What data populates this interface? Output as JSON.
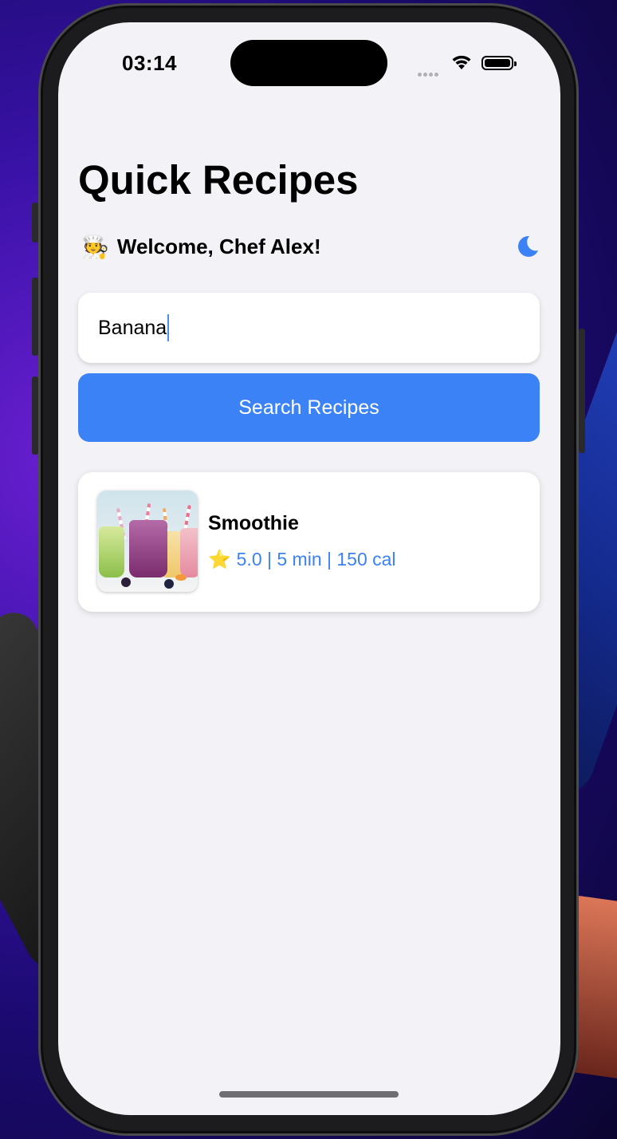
{
  "status_bar": {
    "time": "03:14"
  },
  "app": {
    "title": "Quick Recipes",
    "welcome_emoji": "🧑‍🍳",
    "welcome_text": "Welcome, Chef Alex!",
    "theme_toggle_icon": "moon-icon"
  },
  "search": {
    "value": "Banana",
    "button_label": "Search Recipes"
  },
  "results": [
    {
      "title": "Smoothie",
      "image": "smoothie-photo",
      "rating_icon": "⭐",
      "meta": "5.0 | 5 min | 150 cal"
    }
  ],
  "colors": {
    "accent": "#3b82f6",
    "background": "#f2f2f7",
    "card": "#ffffff"
  }
}
